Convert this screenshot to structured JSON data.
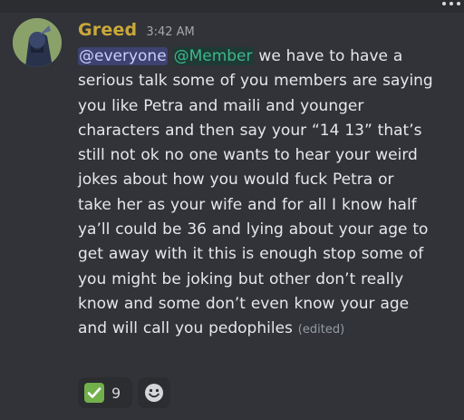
{
  "message": {
    "username": "Greed",
    "timestamp": "3:42 AM",
    "mentions": [
      "@everyone",
      "@Member"
    ],
    "lines": [
      " we have to have a",
      "serious talk some of you members are saying",
      "you like Petra and maili and younger",
      "characters and then say your “14 13” that’s",
      "still not ok no one wants to hear your weird",
      "jokes about how you would fuck Petra or",
      "take her as your wife and for all I know half",
      "ya’ll could be 36 and lying about your age to",
      "get away with it this is enough stop some of",
      "you might be joking but other don’t really",
      "know and some don’t even know your age",
      "and will call you pedophiles"
    ],
    "edited_label": "(edited)"
  },
  "reactions": [
    {
      "icon": "check-mark-button-emoji",
      "count": "9"
    },
    {
      "icon": "add-reaction-smiley-icon"
    }
  ],
  "colors": {
    "background": "#313338",
    "username": "#c9a83a",
    "everyone_mention_bg": "#3d4270",
    "member_mention_text": "#3fb68b",
    "check_emoji": "#72b04b"
  }
}
